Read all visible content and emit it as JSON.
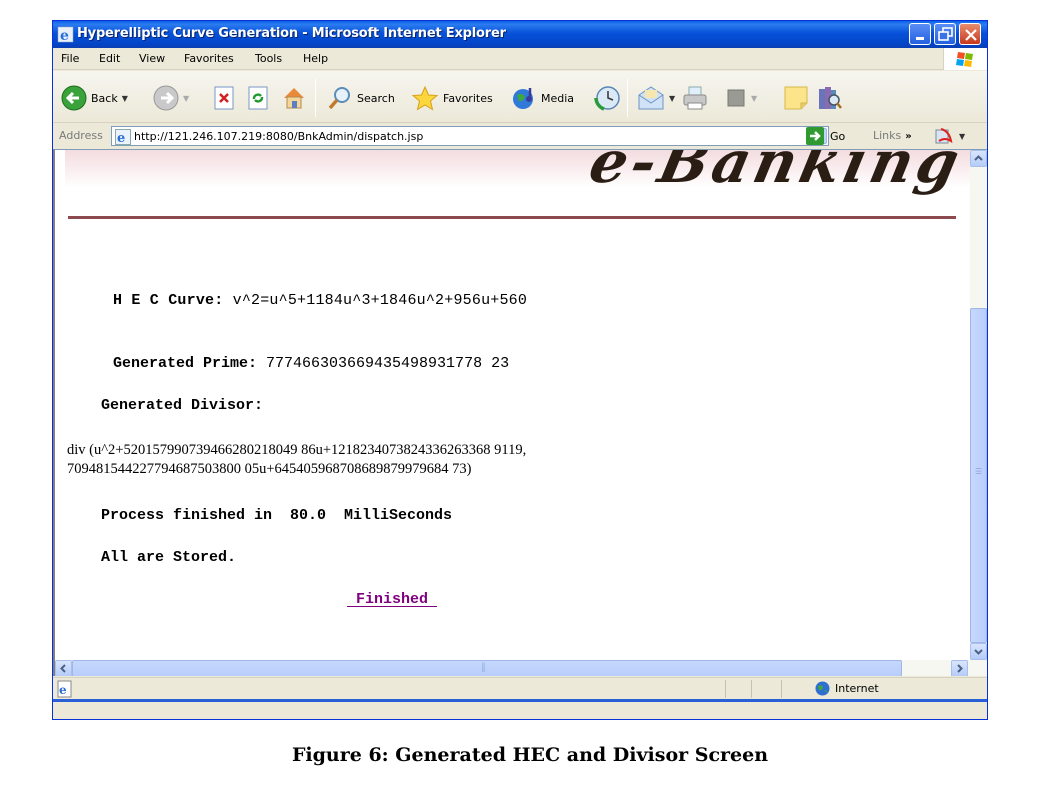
{
  "window": {
    "title": "Hyperelliptic Curve Generation - Microsoft Internet Explorer"
  },
  "menu": {
    "items": [
      "File",
      "Edit",
      "View",
      "Favorites",
      "Tools",
      "Help"
    ]
  },
  "toolbar": {
    "back_label": "Back",
    "search_label": "Search",
    "favorites_label": "Favorites",
    "media_label": "Media"
  },
  "address": {
    "label": "Address",
    "url": "http://121.246.107.219:8080/BnkAdmin/dispatch.jsp",
    "go_label": "Go",
    "links_label": "Links",
    "links_chevron": "»"
  },
  "page": {
    "banner_text": "e-Banking",
    "curve_label": "H E C Curve: ",
    "curve_value": "v^2=u^5+1184u^3+1846u^2+956u+560",
    "prime_label": "Generated Prime: ",
    "prime_value": "777466303669435498931778 23",
    "divisor_label": "Generated Divisor:",
    "divisor_text": "div (u^2+520157990739466280218049 86u+1218234073824336263368 9119,\n709481544227794687503800 05u+645405968708689879979684 73)",
    "process_text": "Process finished in  80.0  MilliSeconds",
    "stored_text": "All are Stored.",
    "finished_link": " Finished "
  },
  "status": {
    "zone_label": "Internet"
  },
  "caption": "Figure 6: Generated HEC and Divisor Screen",
  "scroll": {
    "vertical_position_fraction": 0.33,
    "vertical_visible_fraction": 0.67
  }
}
